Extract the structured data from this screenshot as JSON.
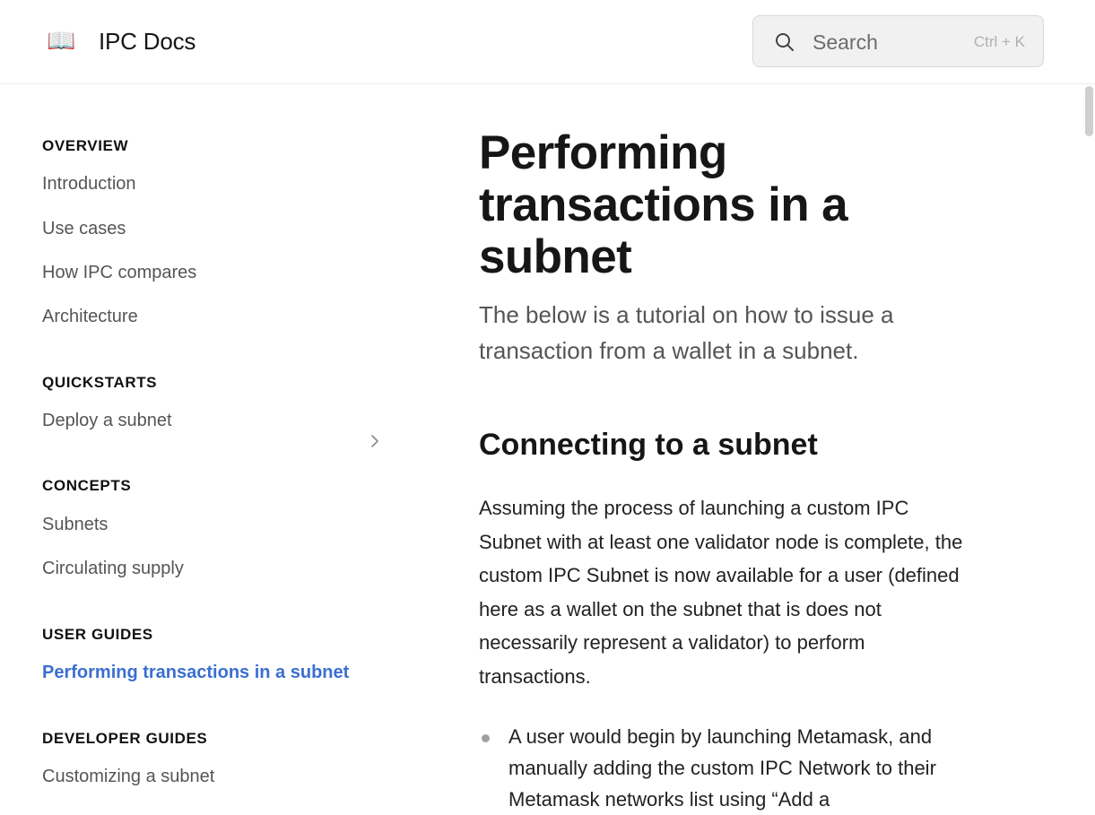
{
  "header": {
    "logo_icon": "book-emoji",
    "logo_glyph": "📖",
    "site_title": "IPC Docs",
    "search": {
      "placeholder": "Search",
      "shortcut": "Ctrl + K",
      "icon": "search-icon"
    }
  },
  "sidebar": {
    "sections": [
      {
        "title": "OVERVIEW",
        "items": [
          "Introduction",
          "Use cases",
          "How IPC compares",
          "Architecture"
        ]
      },
      {
        "title": "QUICKSTARTS",
        "items": [
          "Deploy a subnet"
        ]
      },
      {
        "title": "CONCEPTS",
        "items": [
          "Subnets",
          "Circulating supply"
        ]
      },
      {
        "title": "USER GUIDES",
        "items": [
          "Performing transactions in a subnet"
        ]
      },
      {
        "title": "DEVELOPER GUIDES",
        "items": [
          "Customizing a subnet"
        ]
      }
    ],
    "active_item": "Performing transactions in a subnet",
    "expandable_item": "Subnets"
  },
  "main": {
    "title": "Performing transactions in a subnet",
    "subtitle": "The below is a tutorial on how to issue a transaction from a wallet in a subnet.",
    "section_heading": "Connecting to a subnet",
    "paragraph": "Assuming the process of launching a custom IPC Subnet with at least one validator node is complete, the custom IPC Subnet is now available for a user (defined here as a wallet on the subnet that is does not necessarily represent a validator) to perform transactions.",
    "bullets": [
      "A user would begin by launching Metamask, and manually adding the custom IPC Network to their Metamask networks list using “Add a"
    ]
  },
  "colors": {
    "accent": "#3a6fd0",
    "text": "#1f1f1f",
    "muted": "#555555",
    "search_bg": "#f1f1f1"
  }
}
